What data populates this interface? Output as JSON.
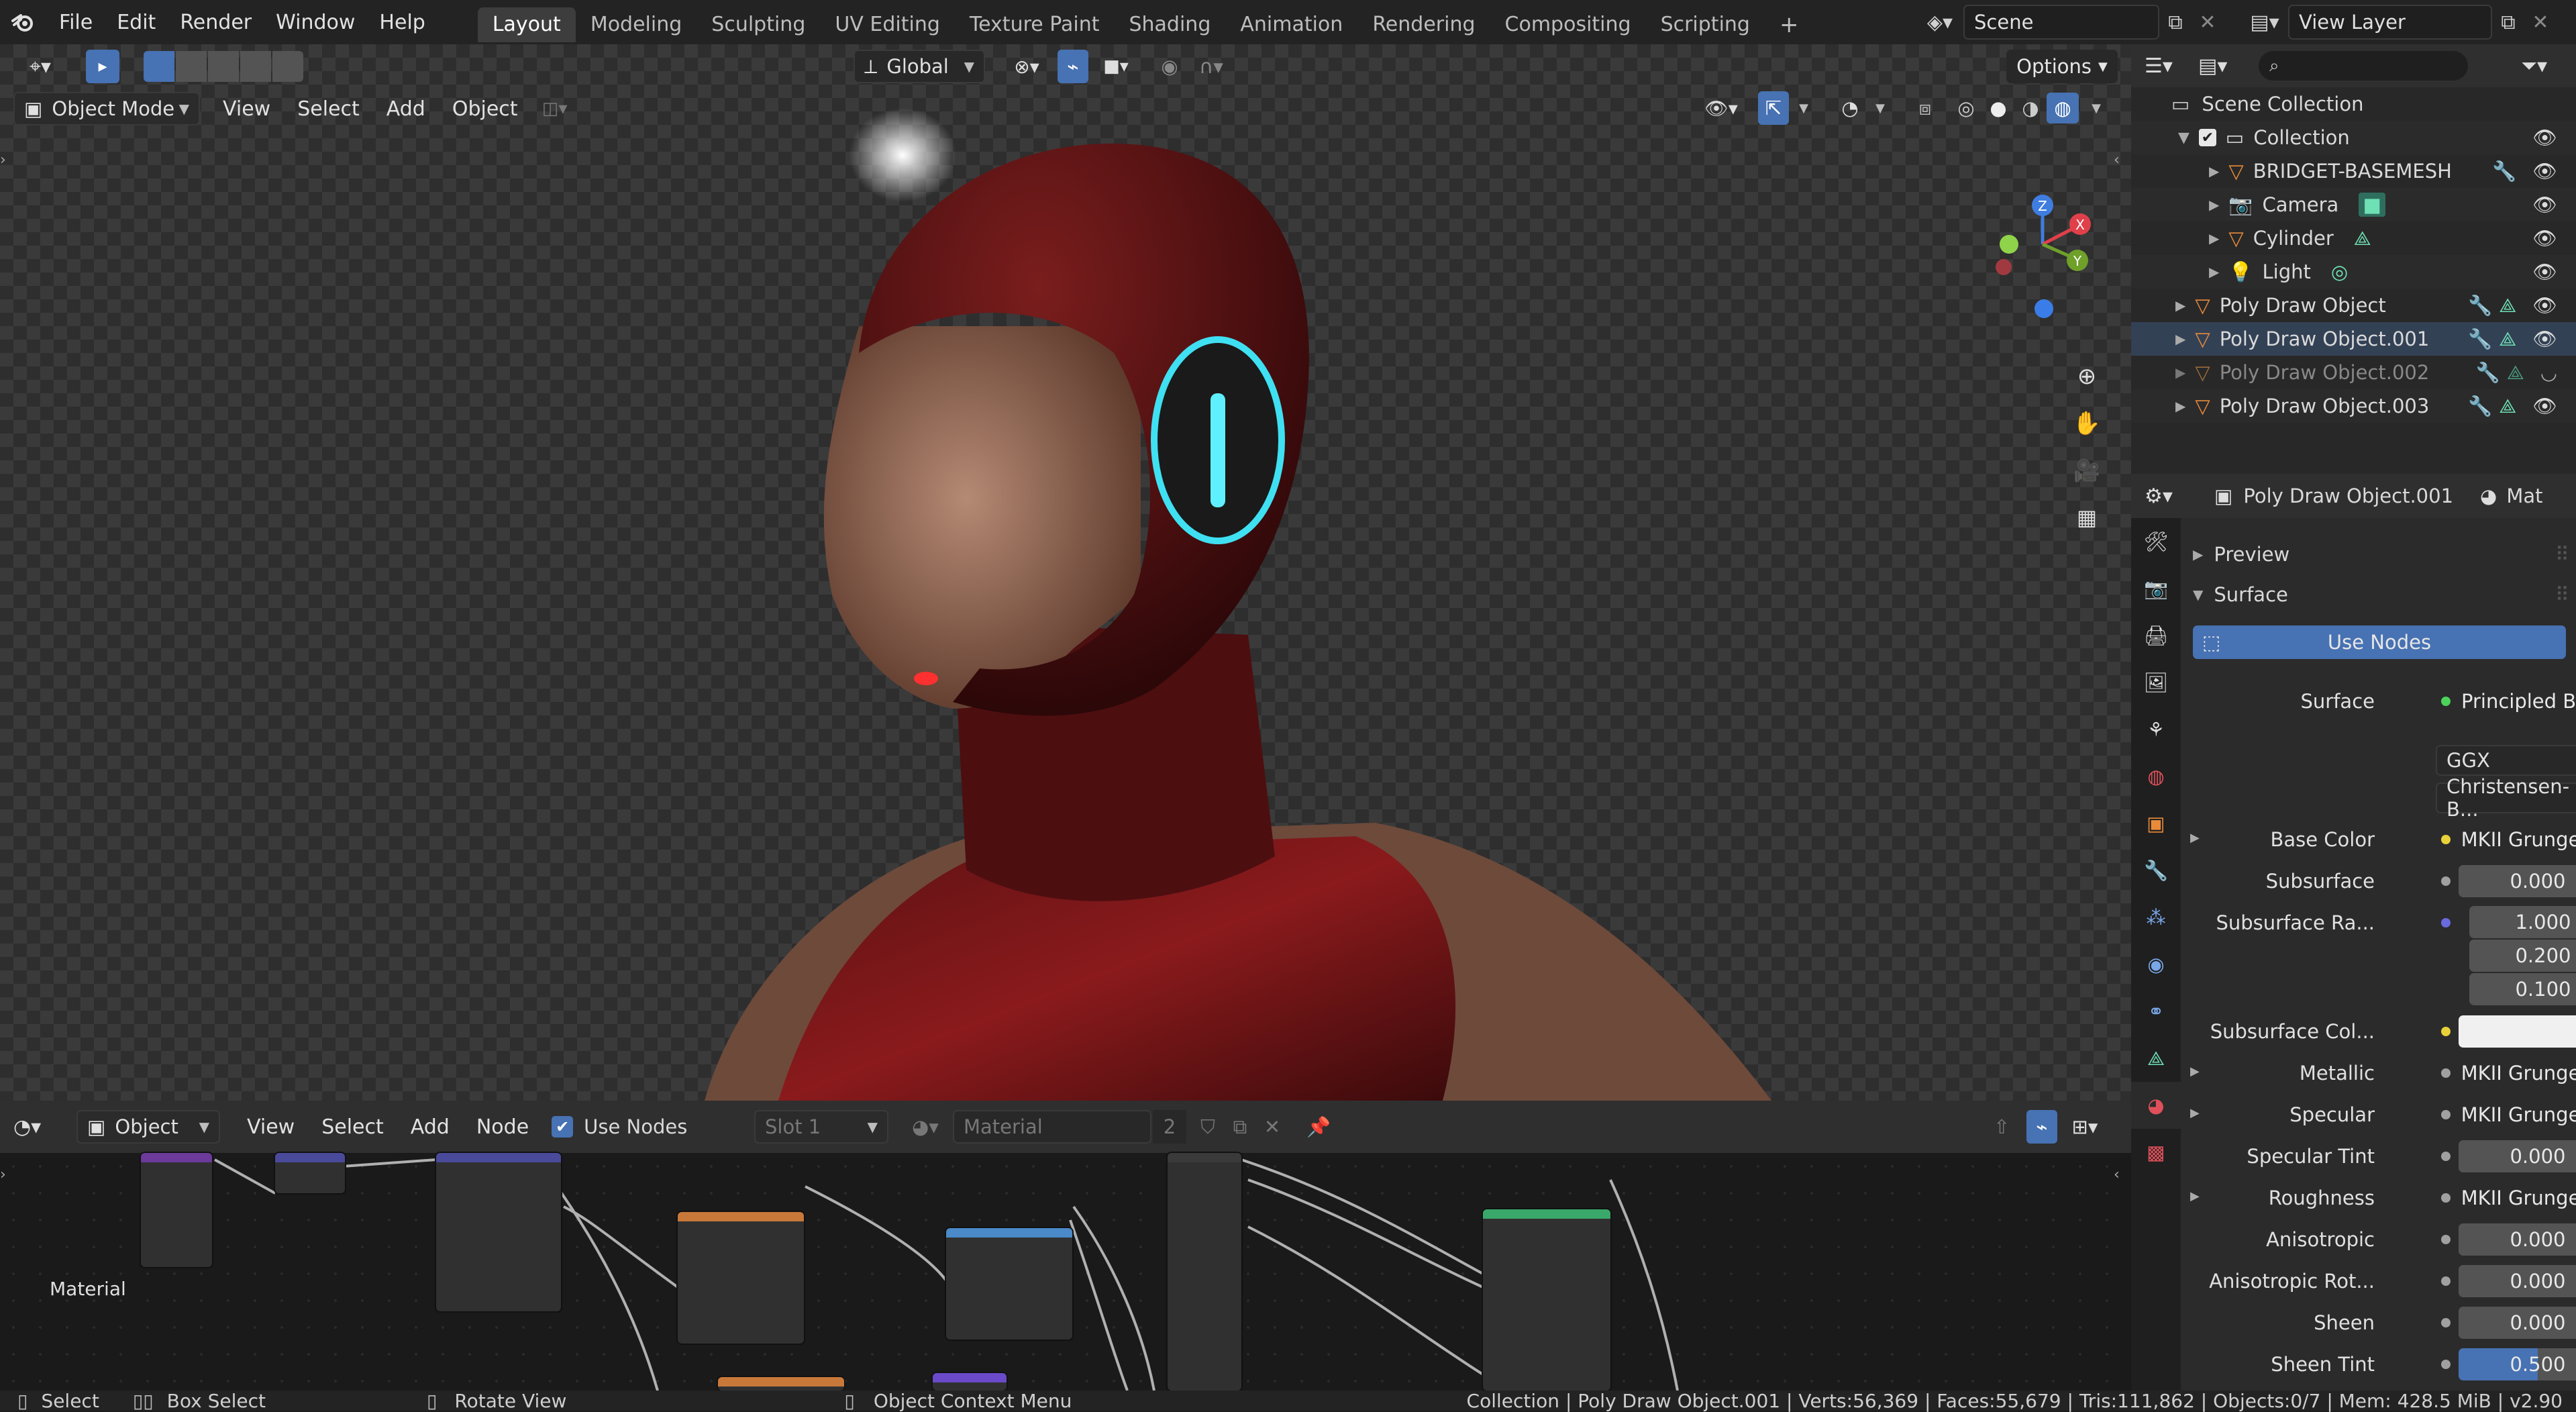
{
  "app_menu": [
    "File",
    "Edit",
    "Render",
    "Window",
    "Help"
  ],
  "workspaces": [
    "Layout",
    "Modeling",
    "Sculpting",
    "UV Editing",
    "Texture Paint",
    "Shading",
    "Animation",
    "Rendering",
    "Compositing",
    "Scripting"
  ],
  "active_workspace": "Layout",
  "add_workspace": "+",
  "scene": {
    "value": "Scene"
  },
  "view_layer": {
    "value": "View Layer"
  },
  "viewport": {
    "orientation": "Global",
    "options_label": "Options",
    "mode": "Object Mode",
    "menus": [
      "View",
      "Select",
      "Add",
      "Object"
    ],
    "gizmo_axes": {
      "z": "Z",
      "x": "X",
      "y": "Y"
    }
  },
  "outliner": {
    "search_placeholder": "",
    "items": [
      {
        "label": "Scene Collection"
      },
      {
        "label": "Collection"
      },
      {
        "label": "BRIDGET-BASEMESH"
      },
      {
        "label": "Camera"
      },
      {
        "label": "Cylinder"
      },
      {
        "label": "Light"
      },
      {
        "label": "Poly Draw Object"
      },
      {
        "label": "Poly Draw Object.001"
      },
      {
        "label": "Poly Draw Object.002"
      },
      {
        "label": "Poly Draw Object.003"
      }
    ]
  },
  "properties": {
    "object_name": "Poly Draw Object.001",
    "material_tab": "Mat",
    "panels": {
      "preview": "Preview",
      "surface": "Surface"
    },
    "use_nodes": "Use Nodes",
    "surface_label": "Surface",
    "surface_shader": "Principled BSDF",
    "distribution": "GGX",
    "subsurface_method": "Christensen-B...",
    "rows": {
      "base_color": {
        "label": "Base Color",
        "value": "MKII Grunge N..."
      },
      "subsurface": {
        "label": "Subsurface",
        "value": "0.000"
      },
      "subsurface_radius": {
        "label": "Subsurface Ra...",
        "v1": "1.000",
        "v2": "0.200",
        "v3": "0.100"
      },
      "subsurface_color": {
        "label": "Subsurface Col..."
      },
      "metallic": {
        "label": "Metallic",
        "value": "MKII Grunge N..."
      },
      "specular": {
        "label": "Specular",
        "value": "MKII Grunge N..."
      },
      "specular_tint": {
        "label": "Specular Tint",
        "value": "0.000"
      },
      "roughness": {
        "label": "Roughness",
        "value": "MKII Grunge N..."
      },
      "anisotropic": {
        "label": "Anisotropic",
        "value": "0.000"
      },
      "anisotropic_rot": {
        "label": "Anisotropic Rot...",
        "value": "0.000"
      },
      "sheen": {
        "label": "Sheen",
        "value": "0.000"
      },
      "sheen_tint": {
        "label": "Sheen Tint",
        "value": "0.500"
      }
    }
  },
  "node_editor": {
    "type": "Object",
    "menus": [
      "View",
      "Select",
      "Add",
      "Node"
    ],
    "use_nodes": "Use Nodes",
    "slot": "Slot 1",
    "material": "Material",
    "users": "2",
    "canvas_label": "Material"
  },
  "status": {
    "select": "Select",
    "box_select": "Box Select",
    "rotate": "Rotate View",
    "context": "Object Context Menu",
    "stats": "Collection | Poly Draw Object.001 | Verts:56,369 | Faces:55,679 | Tris:111,862 | Objects:0/7 | Mem: 428.5 MiB | v2.90"
  },
  "colors": {
    "accent": "#4772b3",
    "active_tab": "#3d3d3d",
    "header": "#232323",
    "panel": "#2b2b2b"
  }
}
